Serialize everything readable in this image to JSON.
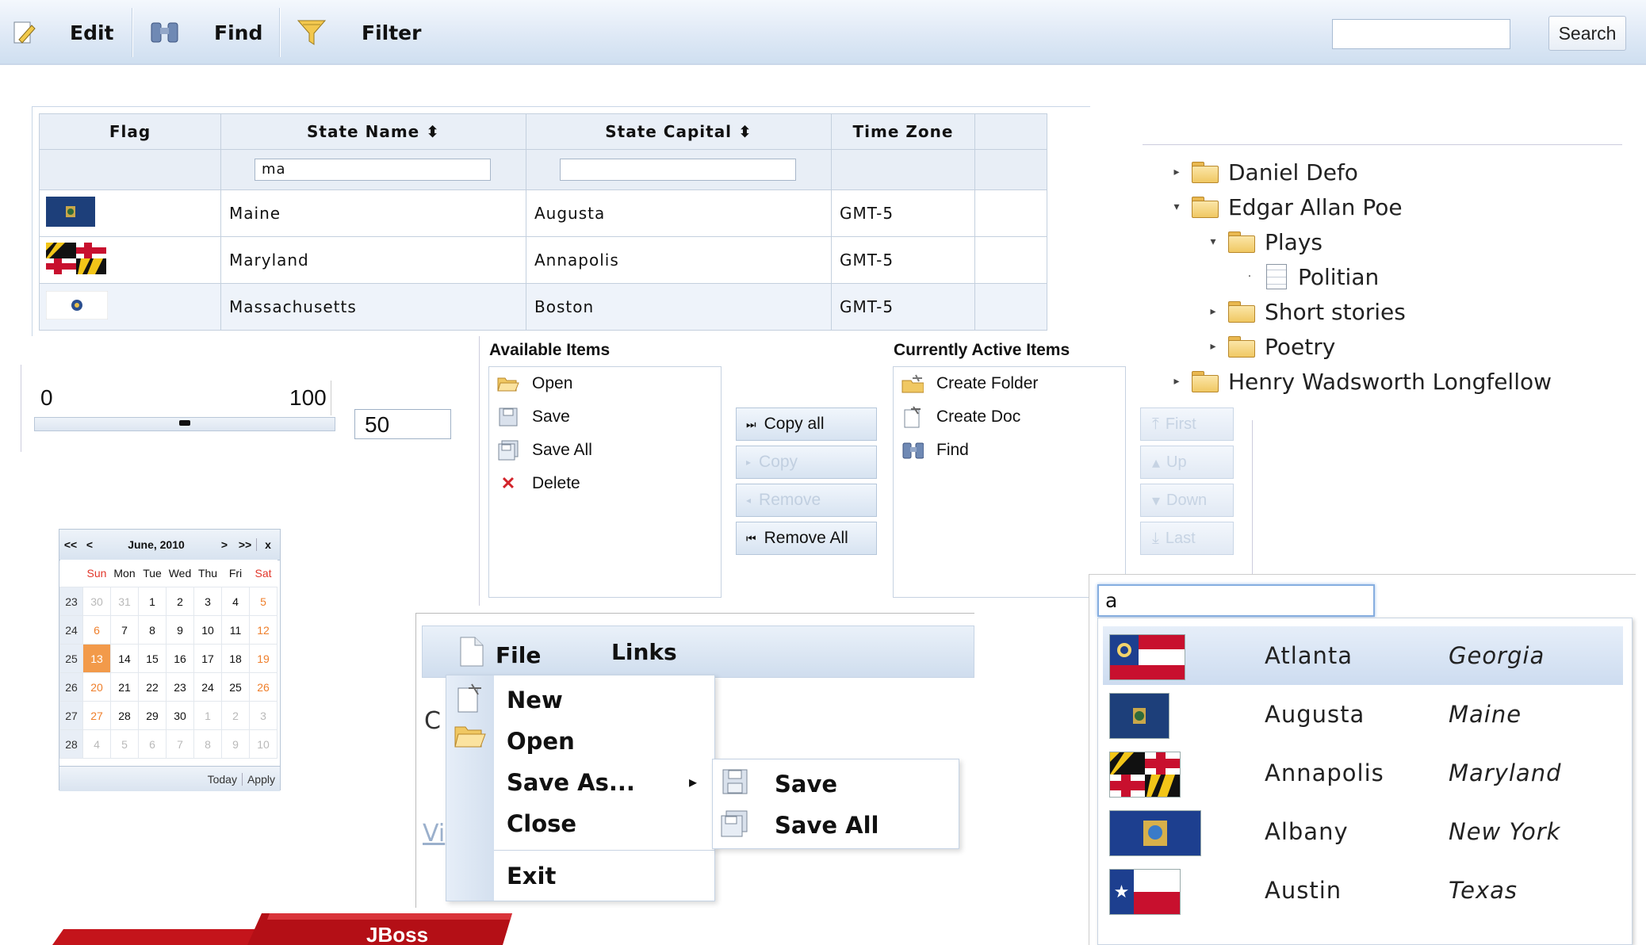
{
  "toolbar": {
    "edit_label": "Edit",
    "find_label": "Find",
    "filter_label": "Filter",
    "search_placeholder": "",
    "search_button": "Search"
  },
  "grid": {
    "columns": [
      "Flag",
      "State Name ⬍",
      "State Capital ⬍",
      "Time Zone"
    ],
    "filters": {
      "state_name": "ma",
      "state_capital": ""
    },
    "rows": [
      {
        "flag": "maine-flag",
        "name": "Maine",
        "capital": "Augusta",
        "tz": "GMT-5"
      },
      {
        "flag": "maryland-flag",
        "name": "Maryland",
        "capital": "Annapolis",
        "tz": "GMT-5"
      },
      {
        "flag": "massachusetts-flag",
        "name": "Massachusetts",
        "capital": "Boston",
        "tz": "GMT-5"
      }
    ]
  },
  "tree": {
    "nodes": [
      "Daniel Defo",
      "Edgar Allan Poe",
      "Plays",
      "Politian",
      "Short stories",
      "Poetry",
      "Henry Wadsworth Longfellow"
    ]
  },
  "slider": {
    "min": "0",
    "max": "100",
    "value": "50",
    "fraction": 0.5
  },
  "list_shuttle": {
    "available_title": "Available Items",
    "active_title": "Currently Active Items",
    "available": [
      "Open",
      "Save",
      "Save All",
      "Delete"
    ],
    "active": [
      "Create Folder",
      "Create Doc",
      "Find"
    ],
    "buttons": [
      "Copy all",
      "Copy",
      "Remove",
      "Remove All"
    ],
    "order_buttons": [
      "First",
      "Up",
      "Down",
      "Last"
    ]
  },
  "calendar": {
    "prev_year": "<<",
    "prev_month": "<",
    "title": "June, 2010",
    "next_month": ">",
    "next_year": ">>",
    "close": "x",
    "dow": [
      "Sun",
      "Mon",
      "Tue",
      "Wed",
      "Thu",
      "Fri",
      "Sat"
    ],
    "weeks": [
      {
        "wk": "23",
        "days": [
          "30",
          "31",
          "1",
          "2",
          "3",
          "4",
          "5"
        ]
      },
      {
        "wk": "24",
        "days": [
          "6",
          "7",
          "8",
          "9",
          "10",
          "11",
          "12"
        ]
      },
      {
        "wk": "25",
        "days": [
          "13",
          "14",
          "15",
          "16",
          "17",
          "18",
          "19"
        ]
      },
      {
        "wk": "26",
        "days": [
          "20",
          "21",
          "22",
          "23",
          "24",
          "25",
          "26"
        ]
      },
      {
        "wk": "27",
        "days": [
          "27",
          "28",
          "29",
          "30",
          "1",
          "2",
          "3"
        ]
      },
      {
        "wk": "28",
        "days": [
          "4",
          "5",
          "6",
          "7",
          "8",
          "9",
          "10"
        ]
      }
    ],
    "today_button": "Today",
    "apply_button": "Apply"
  },
  "menu": {
    "file": "File",
    "links": "Links",
    "items": [
      "New",
      "Open",
      "Save As...",
      "Close",
      "Exit"
    ],
    "submenu": [
      "Save",
      "Save All"
    ],
    "behind_text_1": "C",
    "behind_text_2": "Vi"
  },
  "combo": {
    "input_value": "a",
    "rows": [
      {
        "city": "Atlanta",
        "state": "Georgia",
        "flag": "georgia-flag"
      },
      {
        "city": "Augusta",
        "state": "Maine",
        "flag": "maine-flag"
      },
      {
        "city": "Annapolis",
        "state": "Maryland",
        "flag": "maryland-flag"
      },
      {
        "city": "Albany",
        "state": "New York",
        "flag": "new-york-flag"
      },
      {
        "city": "Austin",
        "state": "Texas",
        "flag": "texas-flag"
      }
    ]
  },
  "banner": {
    "text": "JBoss"
  },
  "colors": {
    "accent": "#f29a4a",
    "banner_red": "#c4141b",
    "header_blue": "#dfe9f6"
  }
}
